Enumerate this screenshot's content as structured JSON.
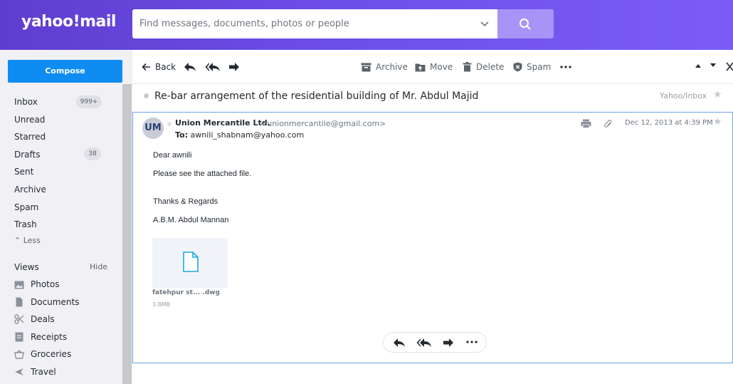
{
  "header": {
    "logo": "yahoo!mail",
    "search_placeholder": "Find messages, documents, photos or people"
  },
  "sidebar": {
    "compose_label": "Compose",
    "folders": [
      {
        "label": "Inbox",
        "badge": "999+"
      },
      {
        "label": "Unread"
      },
      {
        "label": "Starred"
      },
      {
        "label": "Drafts",
        "badge": "38"
      },
      {
        "label": "Sent"
      },
      {
        "label": "Archive"
      },
      {
        "label": "Spam"
      },
      {
        "label": "Trash"
      }
    ],
    "less_label": "Less",
    "views_label": "Views",
    "hide_label": "Hide",
    "views": [
      {
        "label": "Photos",
        "icon": "photos-icon"
      },
      {
        "label": "Documents",
        "icon": "documents-icon"
      },
      {
        "label": "Deals",
        "icon": "deals-icon"
      },
      {
        "label": "Receipts",
        "icon": "receipts-icon"
      },
      {
        "label": "Groceries",
        "icon": "groceries-icon"
      },
      {
        "label": "Travel",
        "icon": "travel-icon"
      }
    ]
  },
  "toolbar": {
    "back_label": "Back",
    "archive_label": "Archive",
    "move_label": "Move",
    "delete_label": "Delete",
    "spam_label": "Spam"
  },
  "message": {
    "subject": "Re-bar arrangement of the residential building of Mr. Abdul Majid",
    "folder": "Yahoo/Inbox",
    "avatar_initials": "UM",
    "sender_name": "Union Mercantile Ltd.",
    "sender_email": "<unionmercantile@gmail.com>",
    "to_prefix": "To:",
    "to_address": "awnili_shabnam@yahoo.com",
    "date": "Dec 12, 2013 at 4:39 PM",
    "body": {
      "greeting": "Dear awnili",
      "line1": "Please see the attached file.",
      "signoff": "Thanks & Regards",
      "signature": "A.B.M. Abdul Mannan"
    },
    "attachment": {
      "name": "fatehpur st... .dwg",
      "size": "3.8MB"
    }
  },
  "colors": {
    "accent": "#0f8cf2",
    "header_start": "#5e3ecf",
    "header_end": "#7b5cf6",
    "search_button": "#a893f6"
  }
}
